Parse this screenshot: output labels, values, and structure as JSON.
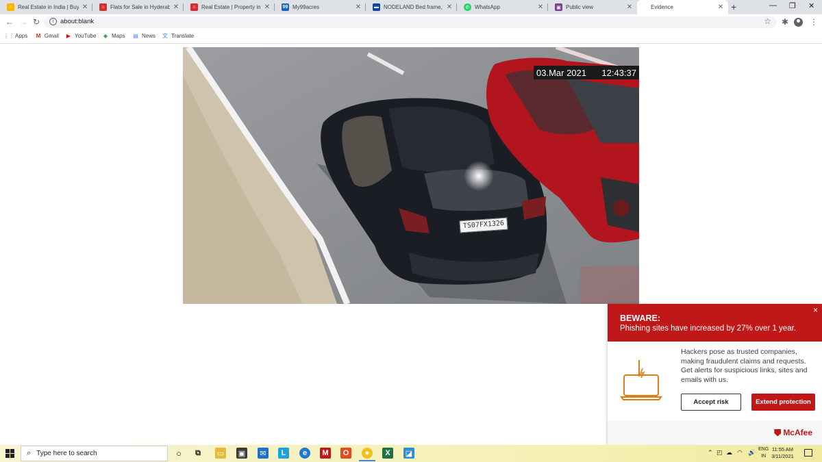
{
  "browser": {
    "tabs": [
      {
        "title": "Real Estate in India | Buy/Se",
        "favicon_color": "#f6b400",
        "favicon": "⌂"
      },
      {
        "title": "Flats for Sale in Hyderabad",
        "favicon_color": "#d32f2f",
        "favicon": "⌂"
      },
      {
        "title": "Real Estate | Property in Ind",
        "favicon_color": "#d32f2f",
        "favicon": "⌂"
      },
      {
        "title": "My99acres",
        "favicon_color": "#1565c0",
        "favicon": "99"
      },
      {
        "title": "NODELAND Bed frame, me",
        "favicon_color": "#0d47a1",
        "favicon": "▬"
      },
      {
        "title": "WhatsApp",
        "favicon_color": "#25d366",
        "favicon": "✆"
      },
      {
        "title": "Public view",
        "favicon_color": "#7b3f8f",
        "favicon": "▣"
      },
      {
        "title": "Evidence",
        "favicon_color": "",
        "favicon": ""
      }
    ],
    "new_tab": "+",
    "window_controls": {
      "minimize": "—",
      "restore": "❐",
      "close": "✕"
    },
    "address": {
      "url": "about:blank"
    },
    "bookmarks": [
      {
        "label": "Apps",
        "icon": "apps-grid-icon",
        "glyph": "⋮⋮",
        "color": "#1a73e8"
      },
      {
        "label": "Gmail",
        "icon": "gmail-icon",
        "glyph": "M",
        "color": "#d93025"
      },
      {
        "label": "YouTube",
        "icon": "youtube-icon",
        "glyph": "▶",
        "color": "#ff0000"
      },
      {
        "label": "Maps",
        "icon": "maps-icon",
        "glyph": "◆",
        "color": "#34a853"
      },
      {
        "label": "News",
        "icon": "news-icon",
        "glyph": "▤",
        "color": "#4285f4"
      },
      {
        "label": "Translate",
        "icon": "translate-icon",
        "glyph": "文",
        "color": "#4285f4"
      }
    ]
  },
  "evidence": {
    "timestamp_date": "03.Mar 2021",
    "timestamp_time": "12:43:37",
    "plate": "TS07FX1326"
  },
  "popup": {
    "title": "BEWARE:",
    "subtitle": "Phishing sites have increased by 27% over 1 year.",
    "body": "Hackers pose as trusted companies, making fraudulent claims and requests. Get alerts for suspicious links, sites and emails with us.",
    "accept_label": "Accept risk",
    "extend_label": "Extend protection",
    "brand": "McAfee",
    "close": "×",
    "accent": "#c01818"
  },
  "taskbar": {
    "search_placeholder": "Type here to search",
    "language_top": "ENG",
    "language_bottom": "IN",
    "time": "11:55 AM",
    "date": "3/11/2021"
  }
}
